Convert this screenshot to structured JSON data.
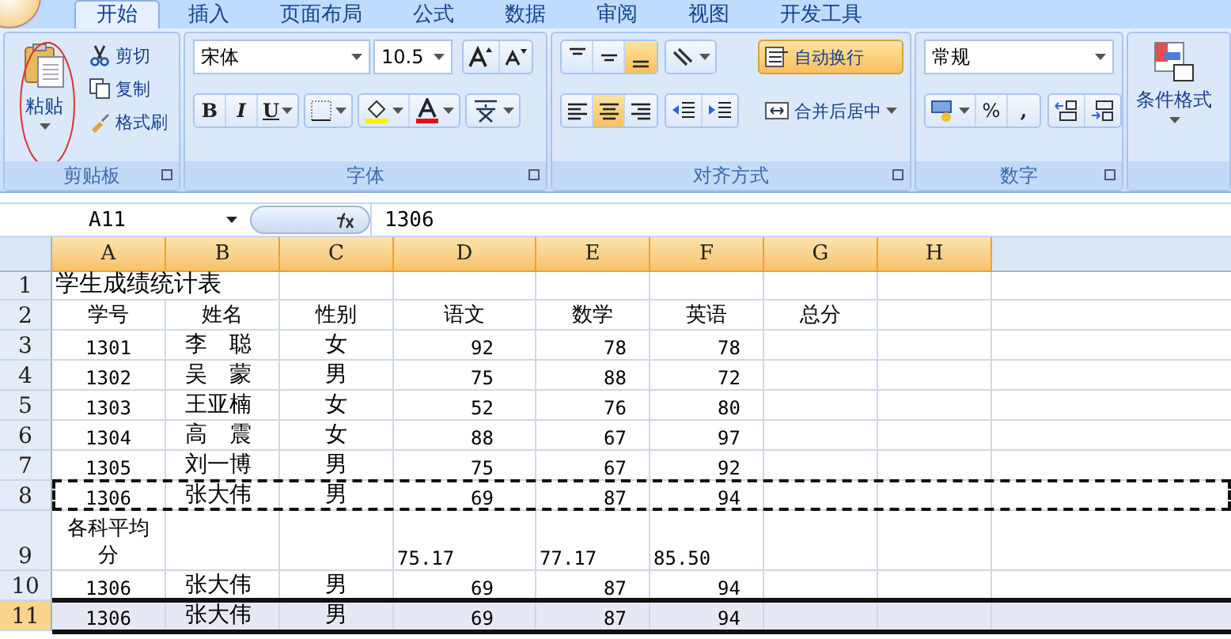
{
  "tabs": [
    {
      "label": "开始",
      "selected": true
    },
    {
      "label": "插入",
      "selected": false
    },
    {
      "label": "页面布局",
      "selected": false
    },
    {
      "label": "公式",
      "selected": false
    },
    {
      "label": "数据",
      "selected": false
    },
    {
      "label": "审阅",
      "selected": false
    },
    {
      "label": "视图",
      "selected": false
    },
    {
      "label": "开发工具",
      "selected": false
    }
  ],
  "clipboard": {
    "label": "剪贴板",
    "paste": "粘贴",
    "items": [
      {
        "kind": "cut",
        "label": "剪切"
      },
      {
        "kind": "copy",
        "label": "复制"
      },
      {
        "kind": "brush",
        "label": "格式刷"
      }
    ]
  },
  "font": {
    "label": "字体",
    "name": "宋体",
    "size": "10.5",
    "styles": [
      {
        "kind": "bold",
        "label": "B"
      },
      {
        "kind": "italic",
        "label": "I"
      },
      {
        "kind": "underline",
        "label": "U"
      }
    ]
  },
  "alignment": {
    "label": "对齐方式",
    "vertical": [
      {
        "kind": "top",
        "selected": false
      },
      {
        "kind": "middle",
        "selected": false
      },
      {
        "kind": "bottom",
        "selected": true
      }
    ],
    "horizontal": [
      {
        "kind": "left",
        "selected": false
      },
      {
        "kind": "center",
        "selected": true
      },
      {
        "kind": "right",
        "selected": false
      }
    ],
    "wrap_text": {
      "label": "自动换行",
      "selected": true
    },
    "merge_center": "合并后居中"
  },
  "number": {
    "label": "数字",
    "format": "常规",
    "percent": "%",
    "comma": ","
  },
  "styles": {
    "conditional_format": "条件格式"
  },
  "formula_bar": {
    "name_box": "A11",
    "value": "1306"
  },
  "columns": [
    "A",
    "B",
    "C",
    "D",
    "E",
    "F",
    "G",
    "H"
  ],
  "rows": [
    {
      "number": "1",
      "kind": "title",
      "selected": false,
      "copied": false,
      "cells": [
        "学生成绩统计表"
      ]
    },
    {
      "number": "2",
      "kind": "header",
      "selected": false,
      "copied": false,
      "cells": [
        "学号",
        "姓名",
        "性别",
        "语文",
        "数学",
        "英语",
        "总分"
      ]
    },
    {
      "number": "3",
      "kind": "data",
      "selected": false,
      "copied": false,
      "cells": [
        "1301",
        "李　聪",
        "女",
        "92",
        "78",
        "78"
      ]
    },
    {
      "number": "4",
      "kind": "data",
      "selected": false,
      "copied": false,
      "cells": [
        "1302",
        "吴　蒙",
        "男",
        "75",
        "88",
        "72"
      ]
    },
    {
      "number": "5",
      "kind": "data",
      "selected": false,
      "copied": false,
      "cells": [
        "1303",
        "王亚楠",
        "女",
        "52",
        "76",
        "80"
      ]
    },
    {
      "number": "6",
      "kind": "data",
      "selected": false,
      "copied": false,
      "cells": [
        "1304",
        "高　震",
        "女",
        "88",
        "67",
        "97"
      ]
    },
    {
      "number": "7",
      "kind": "data",
      "selected": false,
      "copied": false,
      "cells": [
        "1305",
        "刘一博",
        "男",
        "75",
        "67",
        "92"
      ]
    },
    {
      "number": "8",
      "kind": "data",
      "selected": false,
      "copied": true,
      "cells": [
        "1306",
        "张大伟",
        "男",
        "69",
        "87",
        "94"
      ]
    },
    {
      "number": "9",
      "kind": "average",
      "selected": false,
      "copied": false,
      "cells": [
        "各科平均分",
        "",
        "",
        "75.17",
        "77.17",
        "85.50"
      ]
    },
    {
      "number": "10",
      "kind": "data",
      "selected": false,
      "copied": false,
      "cells": [
        "1306",
        "张大伟",
        "男",
        "69",
        "87",
        "94"
      ]
    },
    {
      "number": "11",
      "kind": "data",
      "selected": true,
      "copied": false,
      "cells": [
        "1306",
        "张大伟",
        "男",
        "69",
        "87",
        "94"
      ]
    }
  ]
}
